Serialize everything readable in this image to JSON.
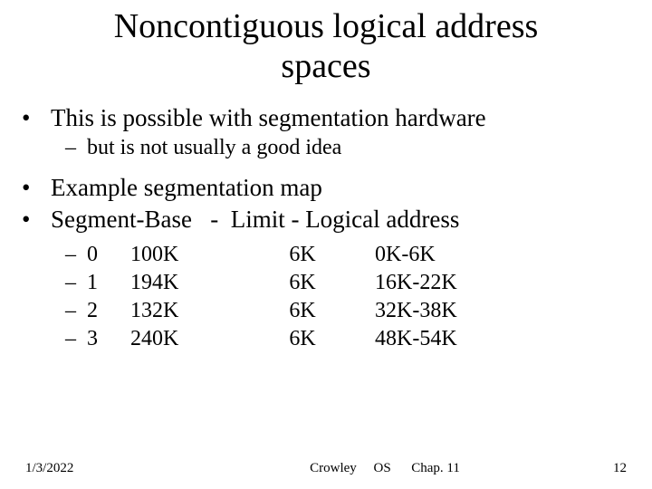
{
  "title_line1": "Noncontiguous logical address",
  "title_line2": "spaces",
  "bullets": {
    "b1": "This is possible with segmentation hardware",
    "b1sub": "but is not usually a good idea",
    "b2": "Example segmentation map",
    "b3": "Segment-Base   -  Limit - Logical address"
  },
  "marker_dot": "•",
  "marker_dash": "–",
  "rows": [
    {
      "seg": "0",
      "base": "100K",
      "limit": "6K",
      "logical": "0K-6K"
    },
    {
      "seg": "1",
      "base": "194K",
      "limit": "6K",
      "logical": "16K-22K"
    },
    {
      "seg": "2",
      "base": "132K",
      "limit": "6K",
      "logical": "32K-38K"
    },
    {
      "seg": "3",
      "base": "240K",
      "limit": "6K",
      "logical": "48K-54K"
    }
  ],
  "footer": {
    "date": "1/3/2022",
    "center": "Crowley     OS      Chap. 11",
    "page": "12"
  },
  "chart_data": {
    "type": "table",
    "title": "Segment-Base - Limit - Logical address",
    "columns": [
      "Segment",
      "Base",
      "Limit",
      "Logical address"
    ],
    "rows": [
      [
        "0",
        "100K",
        "6K",
        "0K-6K"
      ],
      [
        "1",
        "194K",
        "6K",
        "16K-22K"
      ],
      [
        "2",
        "132K",
        "6K",
        "32K-38K"
      ],
      [
        "3",
        "240K",
        "6K",
        "48K-54K"
      ]
    ]
  }
}
